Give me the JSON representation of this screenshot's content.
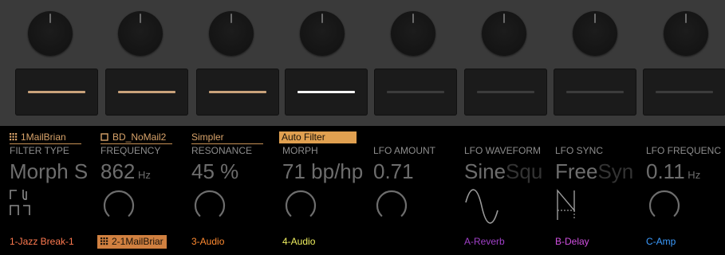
{
  "hardware": {
    "knobs": [
      "knob-1",
      "knob-2",
      "knob-3",
      "knob-4",
      "knob-5",
      "knob-6",
      "knob-7",
      "knob-8"
    ],
    "pads": [
      {
        "led": "#c9a27a"
      },
      {
        "led": "#c9a27a"
      },
      {
        "led": "#c9a27a"
      },
      {
        "led": "#f4f4f4"
      },
      {
        "led": "#3c3c3c"
      },
      {
        "led": "#3c3c3c"
      },
      {
        "led": "#3c3c3c"
      },
      {
        "led": "#3c3c3c"
      }
    ]
  },
  "devices": [
    {
      "label": "1MailBrian",
      "icon": "grid-icon"
    },
    {
      "label": "BD_NoMail2",
      "icon": "square-icon"
    },
    {
      "label": "Simpler"
    },
    {
      "label": "Auto Filter",
      "selected": true
    }
  ],
  "parameters": [
    {
      "name": "FILTER TYPE",
      "value": "Morph S",
      "visual": "filter-type"
    },
    {
      "name": "FREQUENCY",
      "value": "862",
      "unit": " Hz",
      "visual": "dial",
      "level": 0.55
    },
    {
      "name": "RESONANCE",
      "value": "45 %",
      "visual": "dial",
      "level": 0.45
    },
    {
      "name": "MORPH",
      "value": "71 bp/hp",
      "visual": "dial",
      "level": 0.55
    },
    {
      "name": "LFO AMOUNT",
      "value": "0.71",
      "visual": "dial",
      "level": 0.35
    },
    {
      "name": "LFO WAVEFORM",
      "value": "Sine",
      "value_dim": "Squ",
      "visual": "sine"
    },
    {
      "name": "LFO SYNC",
      "value": "Free",
      "value_dim": "Syn",
      "visual": "saw"
    },
    {
      "name": "LFO FREQUENC",
      "value": "0.11",
      "unit": " Hz",
      "visual": "dial",
      "level": 0.35
    }
  ],
  "tracks": [
    {
      "label": "1-Jazz Break-1",
      "color": "#ff7a50"
    },
    {
      "label": "2-1MailBriar",
      "color": "#1a1209",
      "selected": true,
      "icon": "grid-icon"
    },
    {
      "label": "3-Audio",
      "color": "#ff8a30"
    },
    {
      "label": "4-Audio",
      "color": "#f0f060"
    },
    {
      "label": "",
      "color": "#888888"
    },
    {
      "label": "A-Reverb",
      "color": "#a040c8"
    },
    {
      "label": "B-Delay",
      "color": "#d050e0"
    },
    {
      "label": "C-Amp",
      "color": "#3c9cff"
    }
  ],
  "colors": {
    "accent": "#e0a050",
    "screen_bg": "#000000",
    "hardware_bg": "#3a3a3a"
  }
}
